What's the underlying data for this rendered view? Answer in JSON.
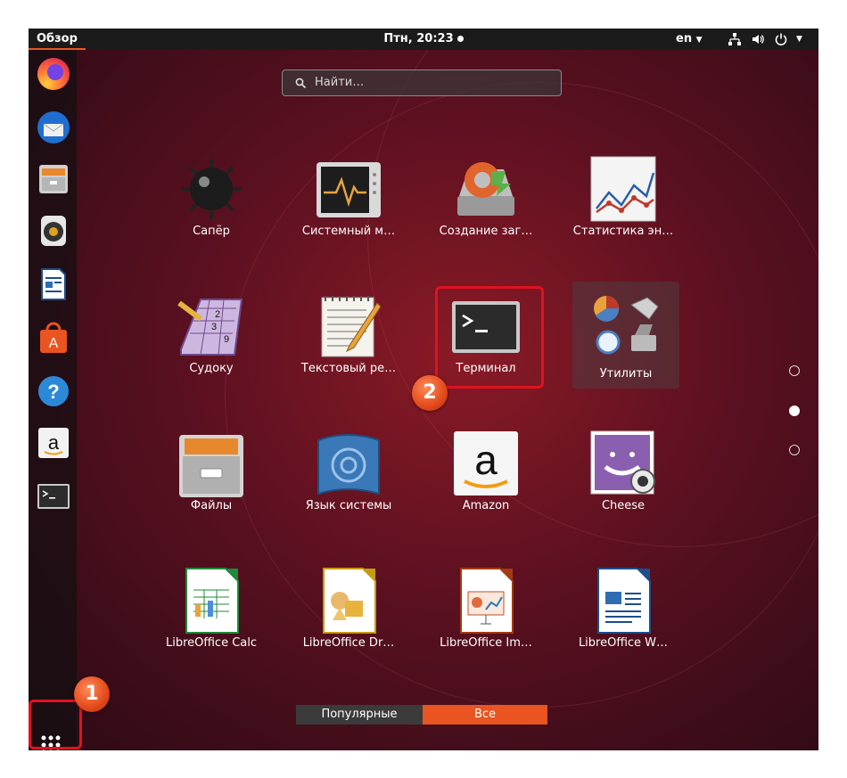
{
  "topbar": {
    "activities": "Обзор",
    "clock": "Птн, 20:23",
    "language": "en"
  },
  "search": {
    "placeholder": "Найти…"
  },
  "apps": [
    {
      "label": "Сапёр",
      "icon": "mines-icon"
    },
    {
      "label": "Системный м…",
      "icon": "system-monitor-icon"
    },
    {
      "label": "Создание заг…",
      "icon": "startup-disk-creator-icon"
    },
    {
      "label": "Статистика эн…",
      "icon": "power-statistics-icon"
    },
    {
      "label": "Судоку",
      "icon": "sudoku-icon"
    },
    {
      "label": "Текстовый ре…",
      "icon": "text-editor-icon"
    },
    {
      "label": "Терминал",
      "icon": "terminal-icon"
    },
    {
      "label": "Утилиты",
      "icon": "utilities-folder-icon"
    },
    {
      "label": "Файлы",
      "icon": "files-icon"
    },
    {
      "label": "Язык системы",
      "icon": "language-support-icon"
    },
    {
      "label": "Amazon",
      "icon": "amazon-icon"
    },
    {
      "label": "Cheese",
      "icon": "cheese-icon"
    },
    {
      "label": "LibreOffice Calc",
      "icon": "libreoffice-calc-icon"
    },
    {
      "label": "LibreOffice Dr…",
      "icon": "libreoffice-draw-icon"
    },
    {
      "label": "LibreOffice Im…",
      "icon": "libreoffice-impress-icon"
    },
    {
      "label": "LibreOffice W…",
      "icon": "libreoffice-writer-icon"
    }
  ],
  "tabs": {
    "frequent": "Популярные",
    "all": "Все",
    "active": "all"
  },
  "annotations": {
    "step1": "1",
    "step2": "2"
  },
  "colors": {
    "accent": "#e95420",
    "highlight": "#e0121f"
  }
}
